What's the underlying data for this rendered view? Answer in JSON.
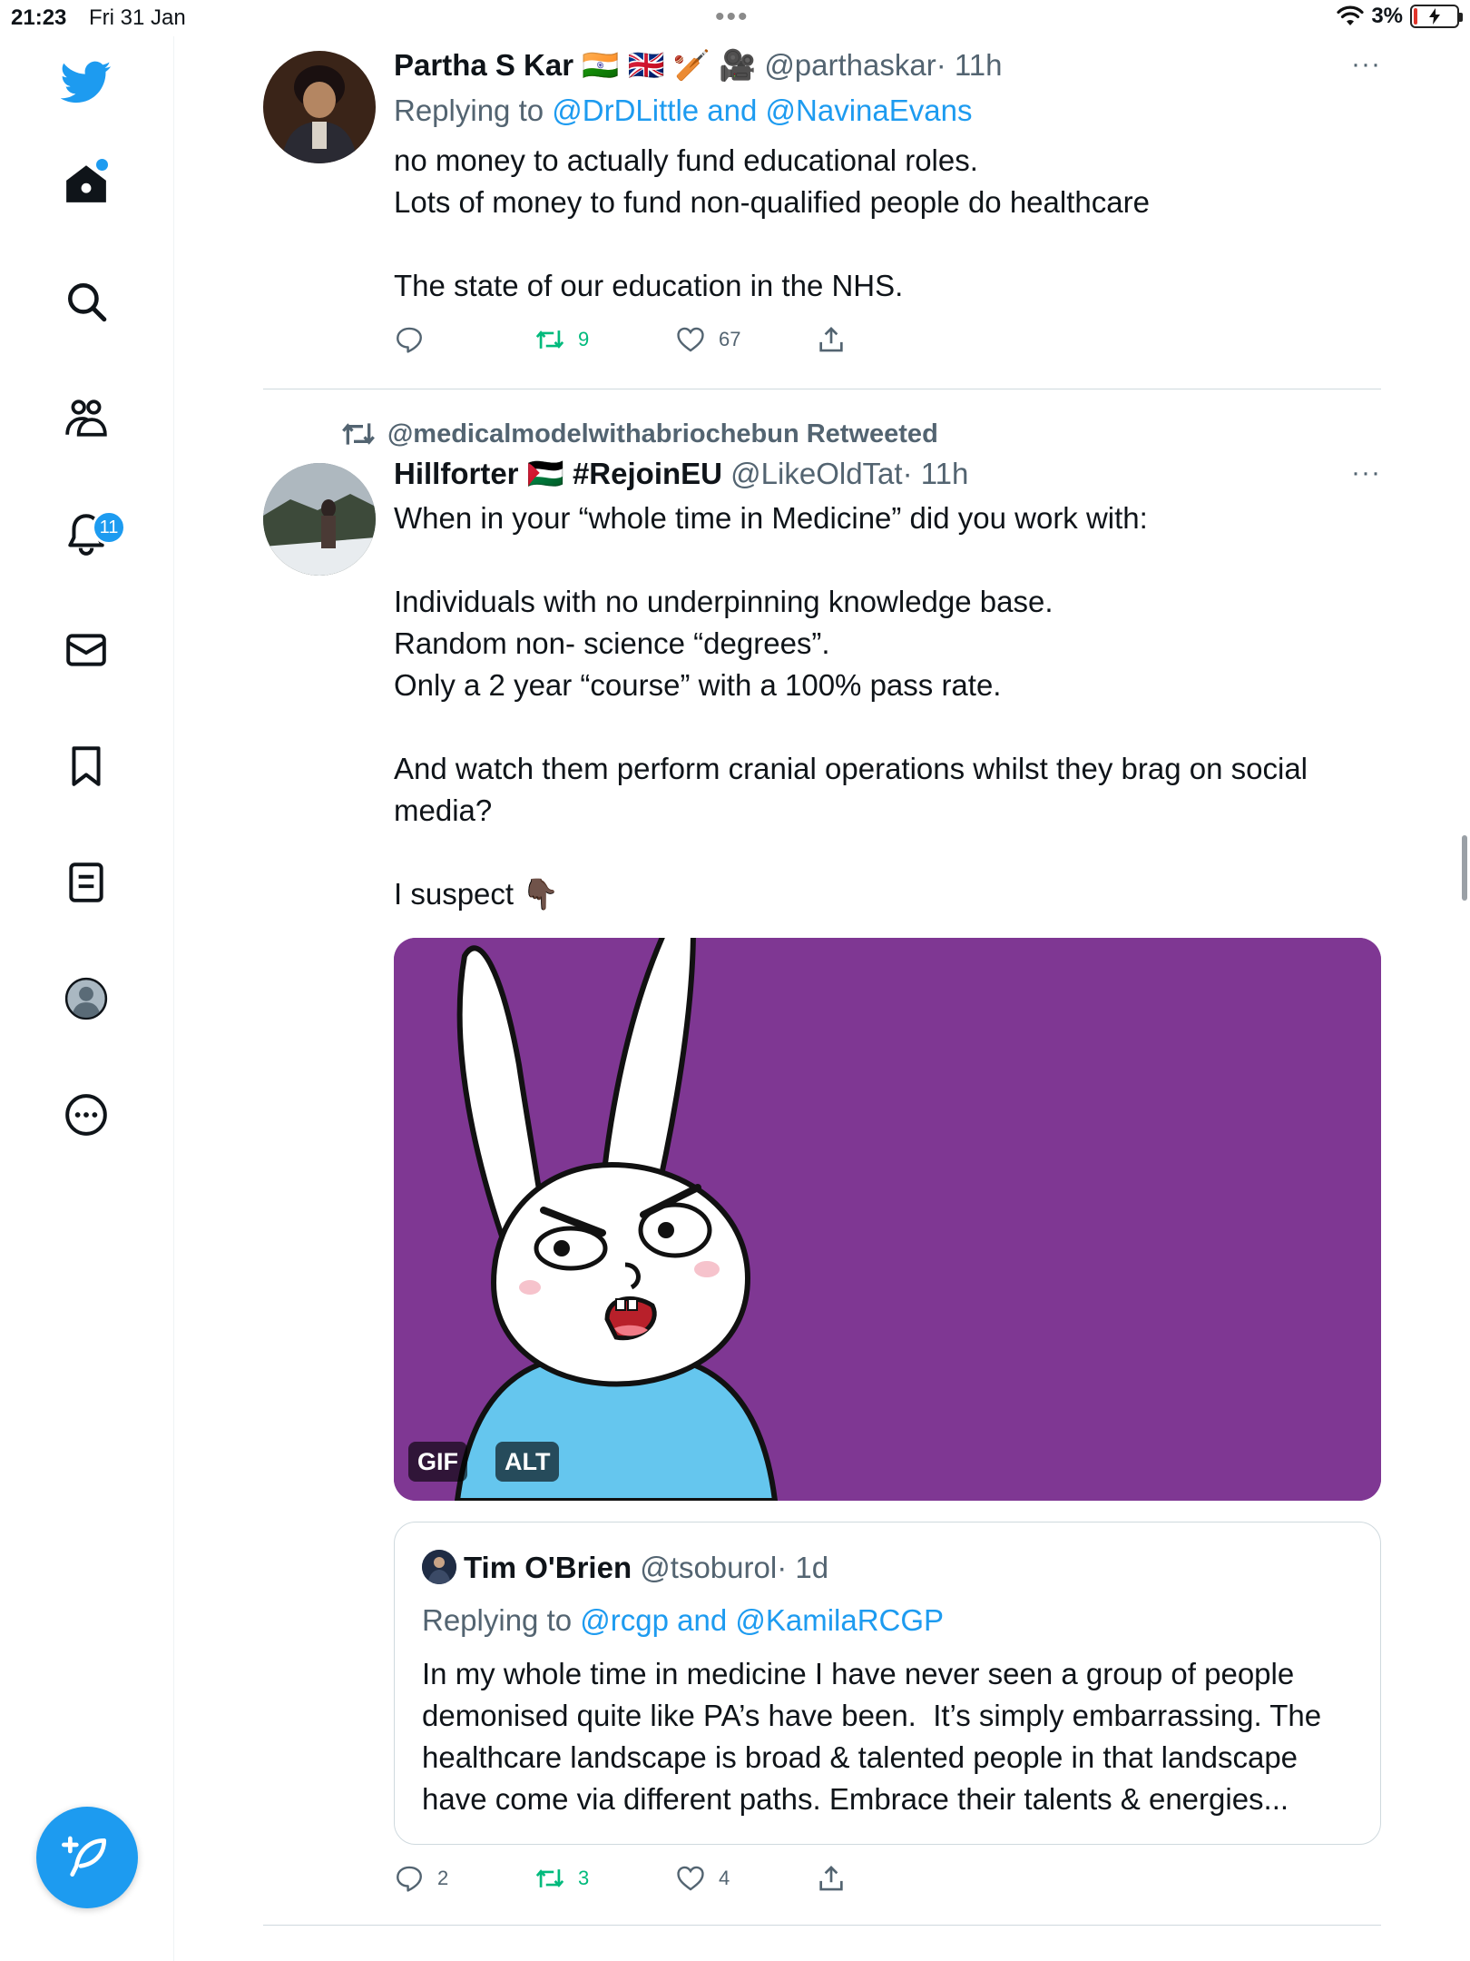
{
  "status_bar": {
    "time": "21:23",
    "date": "Fri 31 Jan",
    "multitask_dots": "•••",
    "battery_percent": "3%"
  },
  "sidebar": {
    "nav": [
      {
        "name": "twitter-logo-icon"
      },
      {
        "name": "home-icon",
        "has_dot": true
      },
      {
        "name": "search-icon"
      },
      {
        "name": "communities-icon"
      },
      {
        "name": "notifications-icon",
        "badge": "11"
      },
      {
        "name": "messages-icon"
      },
      {
        "name": "bookmarks-icon"
      },
      {
        "name": "lists-icon"
      },
      {
        "name": "profile-icon"
      },
      {
        "name": "more-icon"
      }
    ],
    "accent_color": "#1d9bf0"
  },
  "tweets": [
    {
      "display_name": "Partha S Kar",
      "name_emojis": "🇮🇳 🇬🇧 🏏 🎥",
      "handle": "@parthaskar",
      "time": "· 11h",
      "replying_prefix": "Replying to ",
      "replying_to": "@DrDLittle and @NavinaEvans",
      "body": "no money to actually fund educational roles.\nLots of money to fund non-qualified people do healthcare\n\nThe state of our education in the NHS.",
      "more": "···",
      "replies": "",
      "retweets": "9",
      "likes": "67"
    },
    {
      "retweeted_by": "@medicalmodelwithabriochebun Retweeted",
      "display_name": "Hillforter",
      "flag": "🇵🇸",
      "hashtag_name": "#RejoinEU",
      "handle": "@LikeOldTat",
      "time": "· 11h",
      "body": "When in your “whole time in Medicine” did you work with:\n\nIndividuals with no underpinning knowledge base.\nRandom non- science “degrees”.\nOnly a 2 year “course” with a 100% pass rate.\n\nAnd watch them perform cranial operations whilst they brag on social media?\n\nI suspect 👇🏿",
      "more": "···",
      "media": {
        "badge_gif": "GIF",
        "badge_alt": "ALT",
        "background": "#7f3793"
      },
      "quote": {
        "display_name": "Tim O'Brien",
        "handle": "@tsoburol",
        "time": "· 1d",
        "replying_prefix": "Replying to ",
        "replying_to": "@rcgp and @KamilaRCGP",
        "body": "In my whole time in medicine I have never seen a group of people demonised quite like PA’s have been.  It’s simply embarrassing. The healthcare landscape is broad & talented people in that landscape have come via different paths. Embrace their talents & energies..."
      },
      "replies": "2",
      "retweets": "3",
      "likes": "4"
    }
  ],
  "colors": {
    "link": "#1d9bf0",
    "muted": "#536471",
    "retweet_green": "#00ba7c"
  }
}
